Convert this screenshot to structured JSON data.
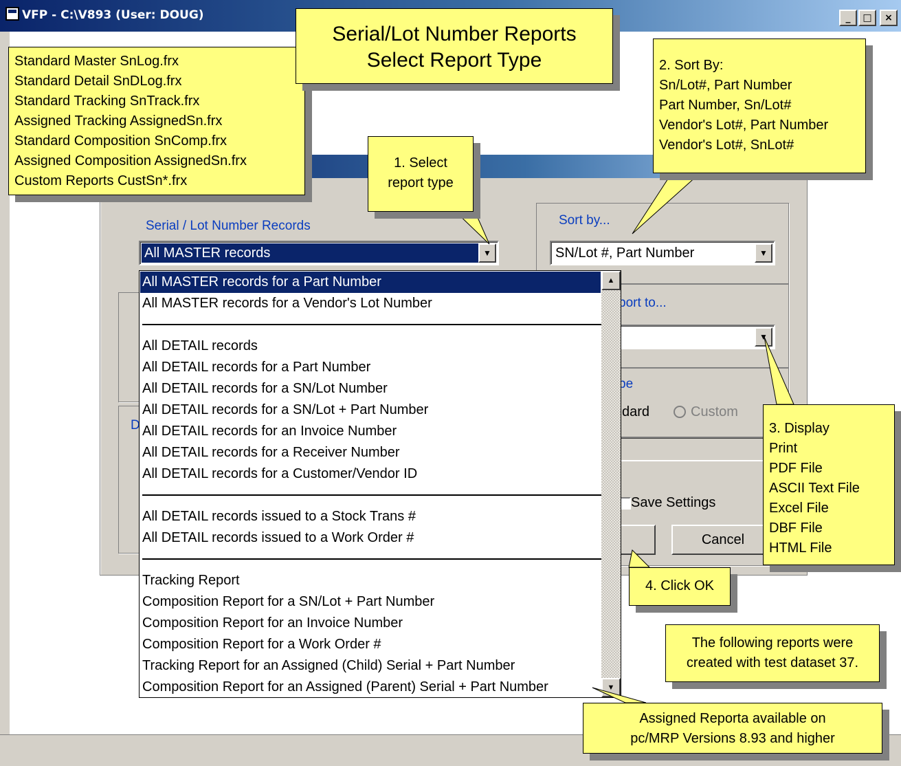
{
  "window": {
    "title": "VFP - C:\\V893  (User: DOUG)",
    "min_glyph": "_",
    "max_glyph": "□",
    "close_glyph": "×"
  },
  "callouts": {
    "title": [
      "Serial/Lot Number Reports",
      "Select Report Type"
    ],
    "report_files": [
      "Standard Master SnLog.frx",
      "Standard Detail SnDLog.frx",
      "Standard Tracking SnTrack.frx",
      "Assigned Tracking AssignedSn.frx",
      "Standard Composition SnComp.frx",
      "Assigned Composition AssignedSn.frx",
      "Custom Reports CustSn*.frx"
    ],
    "step1": [
      "1. Select",
      "report type"
    ],
    "step2": [
      "2. Sort By:",
      "Sn/Lot#, Part Number",
      "Part Number, Sn/Lot#",
      "Vendor's Lot#, Part Number",
      "Vendor's Lot#, SnLot#"
    ],
    "step3": [
      "3. Display",
      "Print",
      "PDF File",
      "ASCII Text File",
      "Excel File",
      "DBF File",
      "HTML File"
    ],
    "step4": "4. Click OK",
    "test_dataset": [
      "The following reports were",
      "created with test dataset 37."
    ],
    "assigned": [
      "Assigned Reporta available on",
      "pc/MRP Versions 8.93 and higher"
    ]
  },
  "dialog": {
    "records_label": "Serial / Lot Number Records",
    "records_value": "All MASTER records",
    "sort_label": "Sort by...",
    "sort_value": "SN/Lot #, Part Number",
    "output_label_partial": "port to...",
    "type_label_partial": "pe",
    "standard_partial": "dard",
    "custom_label": "Custom",
    "save_settings_label": "Save Settings",
    "cancel_label": "Cancel",
    "hidden_letter": "D"
  },
  "dropdown_items": [
    {
      "label": "All MASTER records for a Part Number",
      "selected": true
    },
    {
      "label": "All MASTER records for a Vendor's Lot Number"
    },
    {
      "separator": true
    },
    {
      "label": "All DETAIL records"
    },
    {
      "label": "All DETAIL records for a Part Number"
    },
    {
      "label": "All DETAIL records for a SN/Lot Number"
    },
    {
      "label": "All DETAIL records for a SN/Lot + Part Number"
    },
    {
      "label": "All DETAIL records for an Invoice Number"
    },
    {
      "label": "All DETAIL records for a Receiver Number"
    },
    {
      "label": "All DETAIL records for a Customer/Vendor ID"
    },
    {
      "separator": true
    },
    {
      "label": "All DETAIL records issued to a Stock Trans #"
    },
    {
      "label": "All DETAIL records issued to a Work Order #"
    },
    {
      "separator": true
    },
    {
      "label": "Tracking Report"
    },
    {
      "label": "Composition Report for a SN/Lot + Part Number"
    },
    {
      "label": "Composition Report for an Invoice Number"
    },
    {
      "label": "Composition Report for a Work Order #"
    },
    {
      "label": "Tracking Report for an Assigned (Child) Serial + Part Number"
    },
    {
      "label": "Composition Report for an Assigned (Parent) Serial + Part Number"
    }
  ],
  "icons": {
    "scroll_up": "▲",
    "scroll_down": "▼",
    "combo_down": "▼"
  }
}
